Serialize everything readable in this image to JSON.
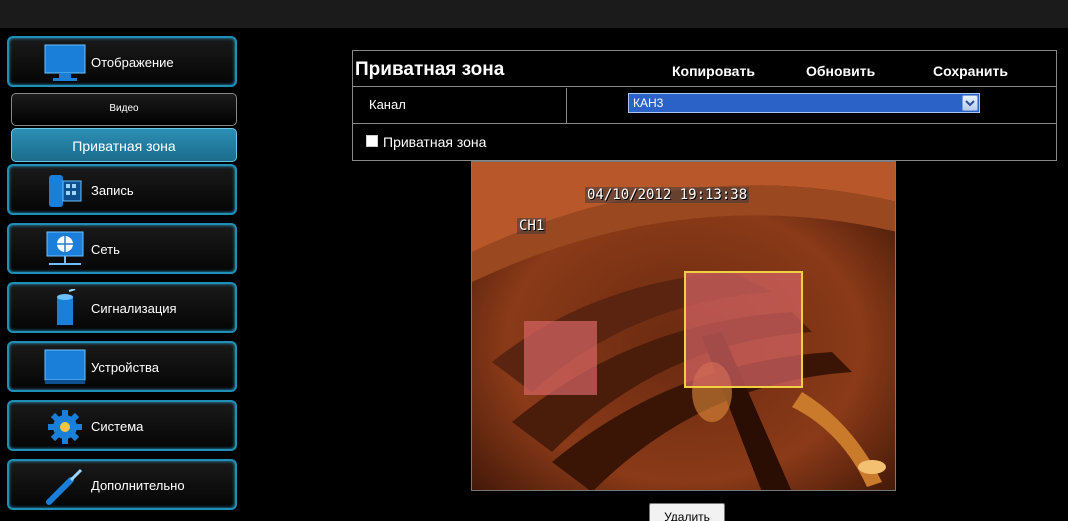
{
  "sidebar": {
    "items": [
      {
        "label": "Отображение",
        "icon": "monitor-icon"
      },
      {
        "label": "Запись",
        "icon": "record-icon"
      },
      {
        "label": "Сеть",
        "icon": "network-icon"
      },
      {
        "label": "Сигнализация",
        "icon": "alarm-icon"
      },
      {
        "label": "Устройства",
        "icon": "devices-icon"
      },
      {
        "label": "Система",
        "icon": "system-gear-icon"
      },
      {
        "label": "Дополнительно",
        "icon": "advanced-tools-icon"
      }
    ],
    "subitems": {
      "video": "Видео",
      "privacy_zone": "Приватная зона"
    }
  },
  "panel": {
    "title": "Приватная зона",
    "actions": {
      "copy": "Копировать",
      "refresh": "Обновить",
      "save": "Сохранить"
    },
    "channel_label": "Канал",
    "channel_value": "КАН3",
    "privacy_checkbox_label": "Приватная зона",
    "privacy_checked": false
  },
  "video": {
    "timestamp": "04/10/2012 19:13:38",
    "channel_osd": "CH1"
  },
  "delete_button": "Удалить",
  "colors": {
    "accent_border": "#1f8fb8",
    "active_item": "#2c8fb4",
    "select_highlight": "#2a62c8",
    "mask_fill": "#d26464",
    "mask_selected_border": "#f0d040"
  }
}
